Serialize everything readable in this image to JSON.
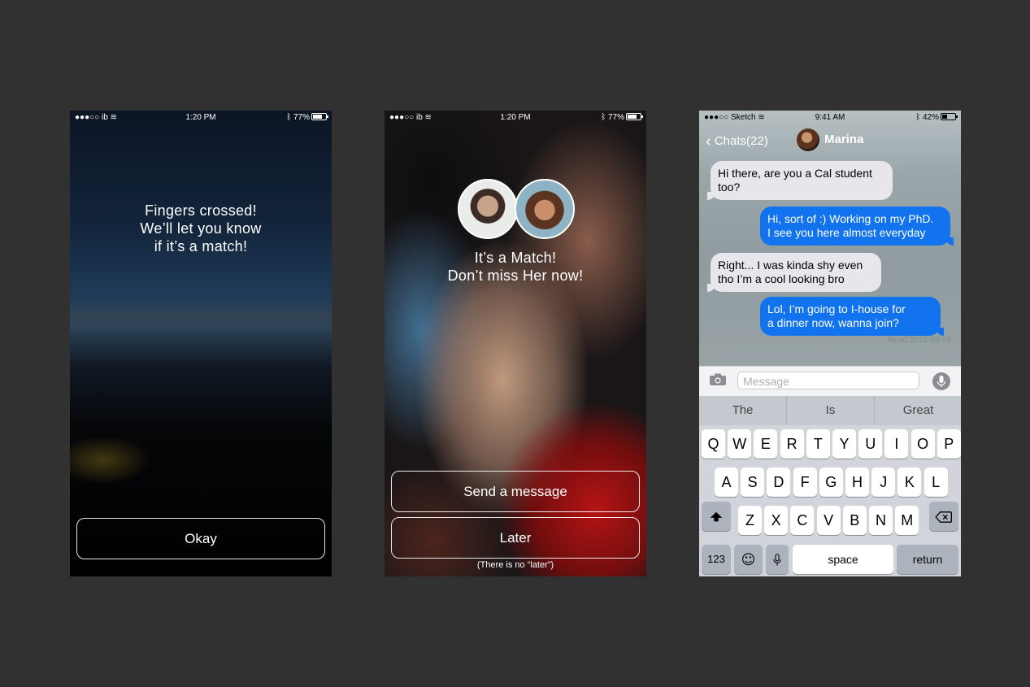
{
  "phone1": {
    "status": {
      "carrier": "●●●○○ ib",
      "time": "1:20 PM",
      "battery": "77%"
    },
    "lines": [
      "Fingers crossed!",
      "We’ll let you know",
      "if it’s a match!"
    ],
    "button": "Okay"
  },
  "phone2": {
    "status": {
      "carrier": "●●●○○ ib",
      "time": "1:20 PM",
      "battery": "77%"
    },
    "lines": [
      "It’s a Match!",
      "Don’t miss Her now!"
    ],
    "primary_button": "Send a message",
    "secondary_button": "Later",
    "note": "(There is no “later”)"
  },
  "phone3": {
    "status": {
      "carrier": "●●●○○ Sketch",
      "time": "9:41 AM",
      "battery": "42%"
    },
    "back_label": "Chats(22)",
    "contact_name": "Marina",
    "messages": [
      {
        "from": "them",
        "lines": [
          "Hi there, are you a Cal student",
          "too?"
        ]
      },
      {
        "from": "me",
        "lines": [
          "Hi, sort of :) Working on my PhD.",
          "I see you here almost everyday"
        ]
      },
      {
        "from": "them",
        "lines": [
          "Right... I was kinda shy even",
          "tho I’m a cool looking bro"
        ]
      },
      {
        "from": "me",
        "lines": [
          "Lol, I’m going to I-house for",
          "a dinner now, wanna join?"
        ]
      }
    ],
    "read_receipt": "Read 2015-09-09",
    "input_placeholder": "Message",
    "suggestions": [
      "The",
      "Is",
      "Great"
    ],
    "keys_row1": [
      "Q",
      "W",
      "E",
      "R",
      "T",
      "Y",
      "U",
      "I",
      "O",
      "P"
    ],
    "keys_row2": [
      "A",
      "S",
      "D",
      "F",
      "G",
      "H",
      "J",
      "K",
      "L"
    ],
    "keys_row3": [
      "Z",
      "X",
      "C",
      "V",
      "B",
      "N",
      "M"
    ],
    "key_123": "123",
    "key_space": "space",
    "key_return": "return"
  }
}
